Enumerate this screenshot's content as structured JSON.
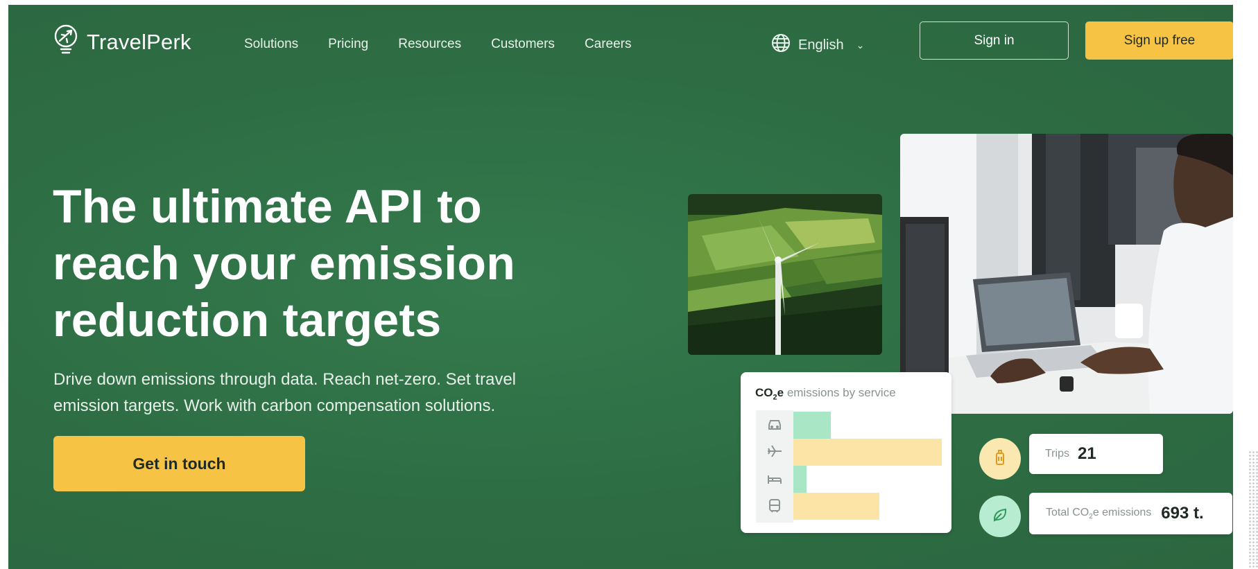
{
  "header": {
    "brand": "TravelPerk",
    "nav": [
      "Solutions",
      "Pricing",
      "Resources",
      "Customers",
      "Careers"
    ],
    "language": "English",
    "signin_label": "Sign in",
    "signup_label": "Sign up free"
  },
  "hero": {
    "title": "The ultimate API to reach your emission reduction targets",
    "subtitle": "Drive down emissions through data. Reach net-zero. Set travel emission targets. Work with carbon compensation solutions.",
    "cta_label": "Get in touch"
  },
  "emissions_card": {
    "title_strong": "CO",
    "title_sub": "2",
    "title_strong_suffix": "e",
    "title_rest": " emissions by service",
    "services": [
      {
        "icon": "car-icon",
        "value": 0.25,
        "color": "#a8e6c6"
      },
      {
        "icon": "plane-icon",
        "value": 1.0,
        "color": "#fbe4a6"
      },
      {
        "icon": "bed-icon",
        "value": 0.09,
        "color": "#a8e6c6"
      },
      {
        "icon": "train-icon",
        "value": 0.58,
        "color": "#fbe4a6"
      }
    ]
  },
  "stats": {
    "trips_label": "Trips",
    "trips_value": "21",
    "total_label_pre": "Total CO",
    "total_label_sub": "2",
    "total_label_post": "e emissions",
    "total_value": "693 t."
  },
  "colors": {
    "background": "#2f7046",
    "accent": "#f6c344",
    "bar_green": "#a8e6c6",
    "bar_yellow": "#fbe4a6"
  }
}
